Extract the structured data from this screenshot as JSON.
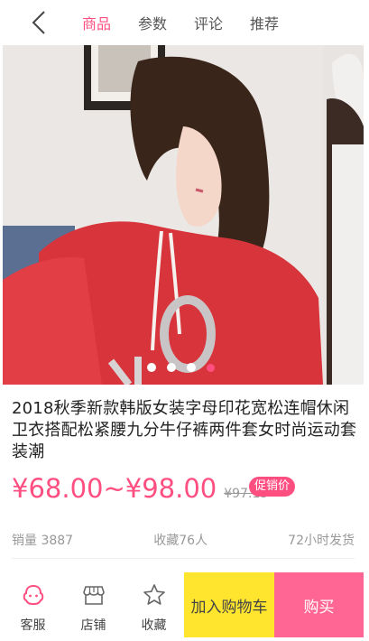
{
  "nav": {
    "tabs": [
      {
        "label": "商品",
        "active": true
      },
      {
        "label": "参数",
        "active": false
      },
      {
        "label": "评论",
        "active": false
      },
      {
        "label": "推荐",
        "active": false
      }
    ]
  },
  "gallery": {
    "image_count": 4,
    "active_index": 3
  },
  "product": {
    "title": "2018秋季新款韩版女装字母印花宽松连帽休闲卫衣搭配松紧腰九分牛仔裤两件套女时尚运动套装潮",
    "price_range": "¥68.00~¥98.00",
    "original_price": "¥97.15",
    "promo_badge": "促销价",
    "sales": "销量 3887",
    "favorites": "收藏76人",
    "shipping": "72小时发货"
  },
  "bottom": {
    "service_label": "客服",
    "store_label": "店铺",
    "collect_label": "收藏",
    "cart_label": "加入购物车",
    "buy_label": "购买"
  },
  "colors": {
    "accent": "#ff4f81",
    "cart_bg": "#ffe52e",
    "buy_bg": "#ff6693"
  }
}
